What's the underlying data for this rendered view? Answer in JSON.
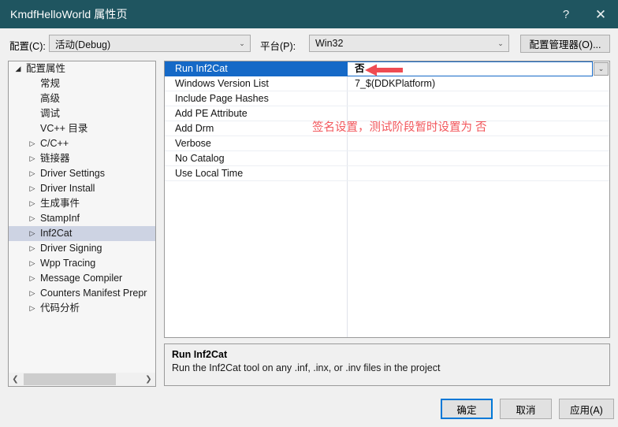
{
  "window": {
    "title": "KmdfHelloWorld 属性页",
    "help_icon": "?",
    "close_icon": "✕"
  },
  "toolbar": {
    "configuration_label": "配置(C):",
    "configuration_value": "活动(Debug)",
    "platform_label": "平台(P):",
    "platform_value": "Win32",
    "config_manager_button": "配置管理器(O)...",
    "dropdown_icon": "⌄"
  },
  "tree": {
    "expander_collapsed": "▷",
    "expander_expanded": "◢",
    "items": [
      {
        "label": "配置属性",
        "indent": 0,
        "expander": "expanded",
        "selected": false
      },
      {
        "label": "常规",
        "indent": 1,
        "expander": "none",
        "selected": false
      },
      {
        "label": "高级",
        "indent": 1,
        "expander": "none",
        "selected": false
      },
      {
        "label": "调试",
        "indent": 1,
        "expander": "none",
        "selected": false
      },
      {
        "label": "VC++ 目录",
        "indent": 1,
        "expander": "none",
        "selected": false
      },
      {
        "label": "C/C++",
        "indent": 1,
        "expander": "collapsed",
        "selected": false
      },
      {
        "label": "链接器",
        "indent": 1,
        "expander": "collapsed",
        "selected": false
      },
      {
        "label": "Driver Settings",
        "indent": 1,
        "expander": "collapsed",
        "selected": false
      },
      {
        "label": "Driver Install",
        "indent": 1,
        "expander": "collapsed",
        "selected": false
      },
      {
        "label": "生成事件",
        "indent": 1,
        "expander": "collapsed",
        "selected": false
      },
      {
        "label": "StampInf",
        "indent": 1,
        "expander": "collapsed",
        "selected": false
      },
      {
        "label": "Inf2Cat",
        "indent": 1,
        "expander": "collapsed",
        "selected": true
      },
      {
        "label": "Driver Signing",
        "indent": 1,
        "expander": "collapsed",
        "selected": false
      },
      {
        "label": "Wpp Tracing",
        "indent": 1,
        "expander": "collapsed",
        "selected": false
      },
      {
        "label": "Message Compiler",
        "indent": 1,
        "expander": "collapsed",
        "selected": false
      },
      {
        "label": "Counters Manifest Prepr",
        "indent": 1,
        "expander": "collapsed",
        "selected": false
      },
      {
        "label": "代码分析",
        "indent": 1,
        "expander": "collapsed",
        "selected": false
      }
    ],
    "scroll_left_icon": "❮",
    "scroll_right_icon": "❯"
  },
  "grid": {
    "rows": [
      {
        "name": "Run Inf2Cat",
        "value": "否",
        "selected": true
      },
      {
        "name": "Windows Version List",
        "value": "7_$(DDKPlatform)",
        "selected": false
      },
      {
        "name": "Include Page Hashes",
        "value": "",
        "selected": false
      },
      {
        "name": "Add PE Attribute",
        "value": "",
        "selected": false
      },
      {
        "name": "Add Drm",
        "value": "",
        "selected": false
      },
      {
        "name": "Verbose",
        "value": "",
        "selected": false
      },
      {
        "name": "No Catalog",
        "value": "",
        "selected": false
      },
      {
        "name": "Use Local Time",
        "value": "",
        "selected": false
      }
    ],
    "value_dropdown_icon": "⌄"
  },
  "annotations": {
    "note_text": "签名设置，测试阶段暂时设置为 否",
    "note_color": "#f2575c",
    "arrow_direction": "left"
  },
  "description": {
    "title": "Run Inf2Cat",
    "body": "Run the Inf2Cat tool on any .inf, .inx, or .inv files in the project"
  },
  "footer": {
    "ok": "确定",
    "cancel": "取消",
    "apply": "应用(A)"
  }
}
